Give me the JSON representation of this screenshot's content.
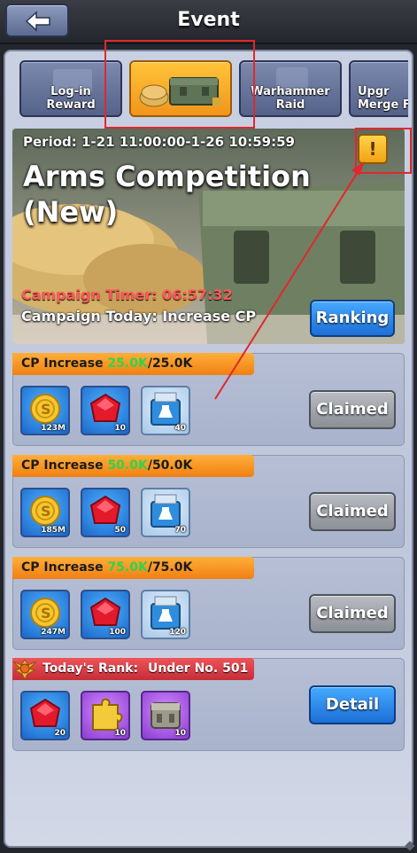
{
  "header": {
    "title": "Event"
  },
  "tabs": [
    {
      "label": "Log-in\nReward",
      "active": false
    },
    {
      "label": "",
      "active": true
    },
    {
      "label": "Warhammer\nRaid",
      "active": false
    },
    {
      "label": "Upgr\nMerge F",
      "active": false
    }
  ],
  "banner": {
    "period": "Period: 1-21 11:00:00-1-26 10:59:59",
    "title": "Arms Competition\n(New)",
    "timer": "Campaign Timer: 06:57:32",
    "today": "Campaign Today: Increase CP",
    "ranking_label": "Ranking",
    "alert_icon": "exclamation-icon"
  },
  "missions": [
    {
      "label": "CP Increase",
      "progress": "25.0K",
      "target": "/25.0K",
      "rewards": [
        {
          "icon": "gold-coin-icon",
          "qty": "123M"
        },
        {
          "icon": "red-gem-icon",
          "qty": "10"
        },
        {
          "icon": "potion-box-icon",
          "qty": "40"
        }
      ],
      "button": "Claimed"
    },
    {
      "label": "CP Increase",
      "progress": "50.0K",
      "target": "/50.0K",
      "rewards": [
        {
          "icon": "gold-coin-icon",
          "qty": "185M"
        },
        {
          "icon": "red-gem-icon",
          "qty": "50"
        },
        {
          "icon": "potion-box-icon",
          "qty": "70"
        }
      ],
      "button": "Claimed"
    },
    {
      "label": "CP Increase",
      "progress": "75.0K",
      "target": "/75.0K",
      "rewards": [
        {
          "icon": "gold-coin-icon",
          "qty": "247M"
        },
        {
          "icon": "red-gem-icon",
          "qty": "100"
        },
        {
          "icon": "potion-box-icon",
          "qty": "120"
        }
      ],
      "button": "Claimed"
    }
  ],
  "rank": {
    "label": "Today's Rank:",
    "value": "Under No. 501",
    "rewards": [
      {
        "icon": "red-gem-icon",
        "qty": "20"
      },
      {
        "icon": "puzzle-piece-icon",
        "qty": "10"
      },
      {
        "icon": "supply-crate-icon",
        "qty": "10"
      }
    ],
    "button": "Detail"
  },
  "colors": {
    "accent_orange": "#f08012",
    "progress_green": "#2fd44b",
    "timer_red": "#ff5a56",
    "button_blue": "#1c6fd6"
  }
}
